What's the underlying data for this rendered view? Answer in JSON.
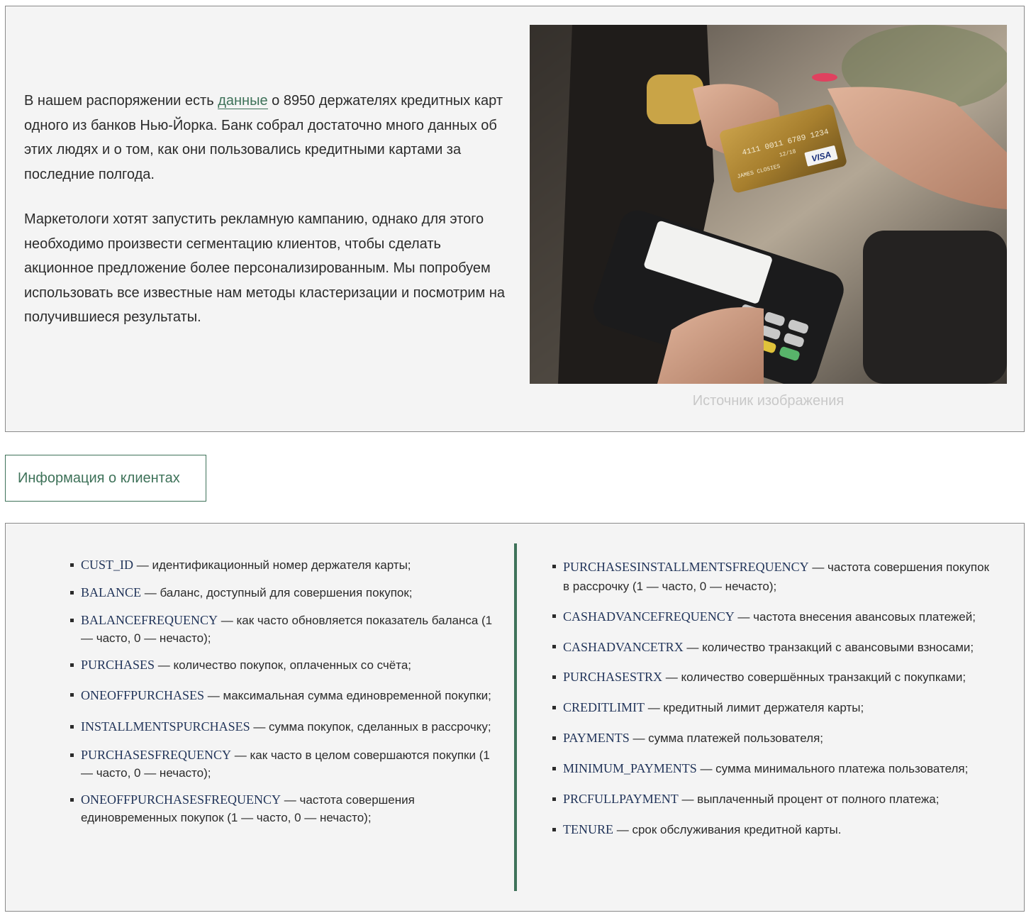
{
  "intro": {
    "p1_before": "В нашем распоряжении есть ",
    "p1_link": "данные",
    "p1_after": " о 8950 держателях кредитных карт одного из банков Нью-Йорка. Банк собрал достаточно много данных об этих людях и о том, как они пользовались кредитными картами за последние полгода.",
    "p2": "Маркетологи хотят запустить рекламную кампанию, однако для этого необходимо произвести сегментацию клиентов, чтобы сделать акционное предложение более персонализированным. Мы попробуем использовать все известные нам методы кластеризации и посмотрим на получившиеся результаты.",
    "caption": "Источник изображения",
    "card_number": "4111 0011 6789 1234",
    "card_expiry": "12/18",
    "card_holder": "JAMES CLOSIES",
    "card_brand": "VISA"
  },
  "tab": {
    "label": "Информация о клиентах"
  },
  "features": {
    "left": [
      {
        "term": "CUST_ID",
        "desc": " — идентификационный номер держателя карты;"
      },
      {
        "term": "BALANCE",
        "desc": " — баланс, доступный для совершения покупок;"
      },
      {
        "term": "BALANCEFREQUENCY",
        "desc": " — как часто обновляется показатель баланса (1 — часто, 0 — нечасто);"
      },
      {
        "term": "PURCHASES",
        "desc": " — количество покупок, оплаченных со счёта;"
      },
      {
        "term": "ONEOFFPURCHASES",
        "desc": " — максимальная сумма единовременной покупки;"
      },
      {
        "term": "INSTALLMENTSPURCHASES",
        "desc": " — сумма покупок, сделанных в рассрочку;"
      },
      {
        "term": "PURCHASESFREQUENCY",
        "desc": " — как часто в целом совершаются покупки (1 — часто, 0 — нечасто);"
      },
      {
        "term": "ONEOFFPURCHASESFREQUENCY",
        "desc": " — частота совершения единовременных покупок (1 — часто, 0 — нечасто);"
      }
    ],
    "right": [
      {
        "term": "PURCHASESINSTALLMENTSFREQUENCY",
        "desc": " — частота совершения покупок в рассрочку (1 — часто, 0 — нечасто);"
      },
      {
        "term": "CASHADVANCEFREQUENCY",
        "desc": " — частота внесения авансовых платежей;"
      },
      {
        "term": "CASHADVANCETRX",
        "desc": " — количество транзакций с авансовыми взносами;"
      },
      {
        "term": "PURCHASESTRX",
        "desc": " — количество совершённых транзакций с покупками;"
      },
      {
        "term": "CREDITLIMIT",
        "desc": " — кредитный лимит держателя карты;"
      },
      {
        "term": "PAYMENTS",
        "desc": " — сумма платежей пользователя;"
      },
      {
        "term": "MINIMUM_PAYMENTS",
        "desc": " — сумма минимального платежа пользователя;"
      },
      {
        "term": "PRCFULLPAYMENT",
        "desc": " — выплаченный процент от полного платежа;"
      },
      {
        "term": "TENURE",
        "desc": " — срок обслуживания кредитной карты."
      }
    ]
  }
}
